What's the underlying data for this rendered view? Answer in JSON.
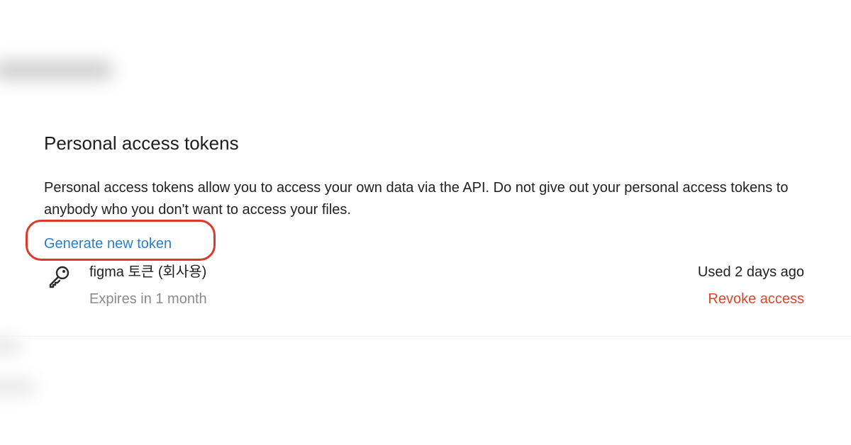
{
  "section": {
    "title": "Personal access tokens",
    "description": "Personal access tokens allow you to access your own data via the API. Do not give out your personal access tokens to anybody who you don't want to access your files.",
    "generate_label": "Generate new token"
  },
  "tokens": [
    {
      "name": "figma 토큰 (회사용)",
      "expiry": "Expires in 1 month",
      "last_used": "Used 2 days ago",
      "revoke_label": "Revoke access",
      "icon": "key-icon"
    }
  ],
  "colors": {
    "link": "#2a7fc7",
    "revoke": "#d9472b",
    "highlight": "#d93b2b",
    "muted_text": "#8a8a8a"
  }
}
